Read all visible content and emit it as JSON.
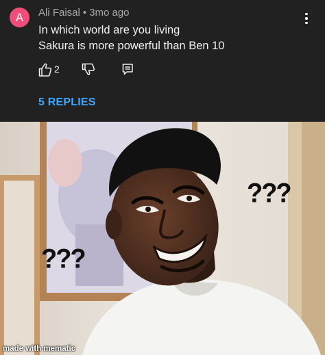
{
  "comment": {
    "avatar_letter": "A",
    "avatar_color": "#ef4e7b",
    "author": "Ali Faisal",
    "separator": "•",
    "time": "3mo ago",
    "lines": [
      "In which world are you living",
      "Sakura is more powerful than Ben 10"
    ],
    "like_count": "2",
    "replies_label": "5 REPLIES",
    "accent_color": "#3ea6ff",
    "icons": [
      "thumbs-up-icon",
      "thumbs-down-icon",
      "reply-icon",
      "more-vert-icon"
    ]
  },
  "meme": {
    "left_caption": "???",
    "right_caption": "???",
    "watermark": "made with mematic"
  }
}
